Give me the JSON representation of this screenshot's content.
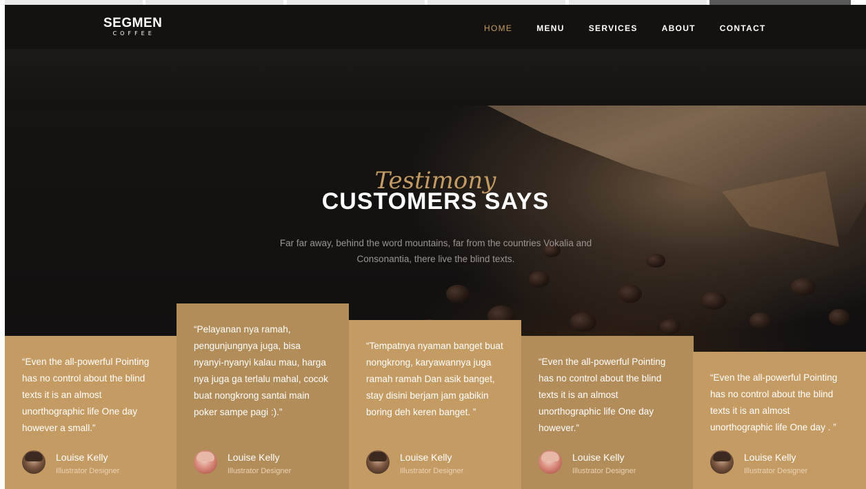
{
  "brand": {
    "name": "SEGMEN",
    "tagline": "COFFEE"
  },
  "nav": {
    "items": [
      {
        "label": "HOME",
        "active": true
      },
      {
        "label": "MENU",
        "active": false
      },
      {
        "label": "SERVICES",
        "active": false
      },
      {
        "label": "ABOUT",
        "active": false
      },
      {
        "label": "CONTACT",
        "active": false
      }
    ]
  },
  "hero": {
    "script_heading": "Testimony",
    "heading": "CUSTOMERS SAYS",
    "subtitle": "Far far away, behind the word mountains, far from the countries Vokalia and Consonantia, there live the blind texts."
  },
  "testimonials": [
    {
      "quote": "“Even the all-powerful Pointing has no control about the blind texts it is an almost unorthographic life One day however a small.”",
      "name": "Louise Kelly",
      "role": "Illustrator Designer",
      "avatar": "avatar-man"
    },
    {
      "quote": "“Pelayanan nya ramah, pengunjungnya juga, bisa nyanyi-nyanyi kalau mau, harga nya juga ga terlalu mahal, cocok buat nongkrong santai main poker sampe pagi :).”",
      "name": "Louise Kelly",
      "role": "Illustrator Designer",
      "avatar": "avatar-woman"
    },
    {
      "quote": "“Tempatnya nyaman banget buat nongkrong, karyawannya juga ramah ramah Dan asik banget, stay disini berjam jam gabikin boring deh keren banget. ”",
      "name": "Louise Kelly",
      "role": "Illustrator Designer",
      "avatar": "avatar-man"
    },
    {
      "quote": "“Even the all-powerful Pointing has no control about the blind texts it is an almost unorthographic life One day however.”",
      "name": "Louise Kelly",
      "role": "Illustrator Designer",
      "avatar": "avatar-woman"
    },
    {
      "quote": "“Even the all-powerful Pointing has no control about the blind texts it is an almost unorthographic life One day . ”",
      "name": "Louise Kelly",
      "role": "Illustrator Designer",
      "avatar": "avatar-man"
    }
  ],
  "colors": {
    "accent": "#c49b63",
    "accent_dark": "#b28c59",
    "header_bg": "#15110f"
  }
}
